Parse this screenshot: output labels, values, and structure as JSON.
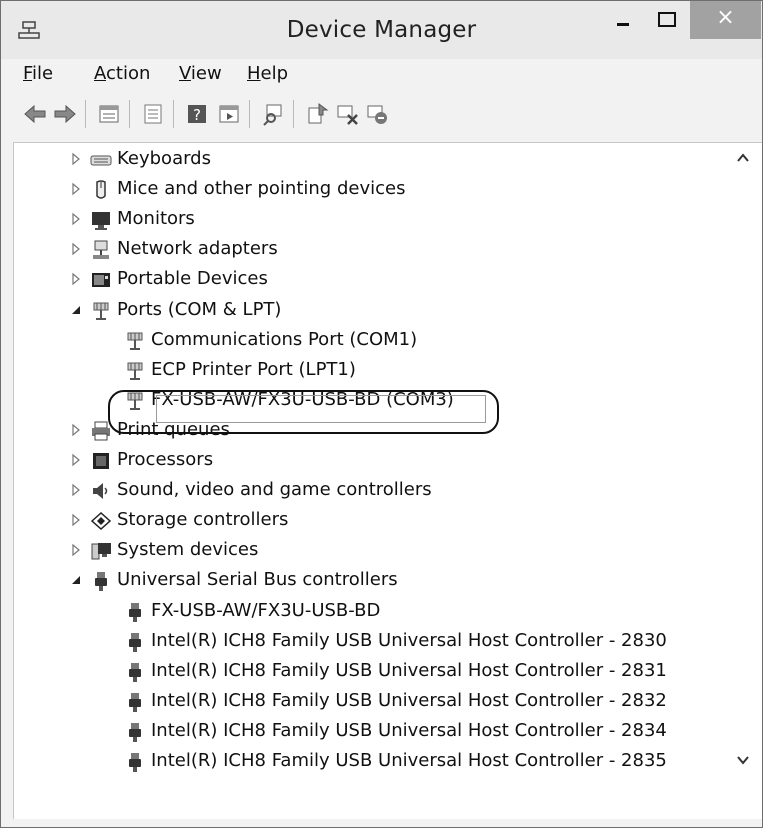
{
  "window": {
    "title": "Device Manager",
    "close_glyph": "×"
  },
  "menubar": {
    "items": [
      {
        "label": "File",
        "mnemonic": "F"
      },
      {
        "label": "Action",
        "mnemonic": "A"
      },
      {
        "label": "View",
        "mnemonic": "V"
      },
      {
        "label": "Help",
        "mnemonic": "H"
      }
    ]
  },
  "toolbar": {
    "buttons": [
      "back-arrow-icon",
      "forward-arrow-icon",
      "properties-icon",
      "view-list-icon",
      "help-icon",
      "run-icon",
      "scan-hardware-icon",
      "update-driver-icon",
      "disable-device-icon",
      "uninstall-device-icon"
    ]
  },
  "tree": {
    "items": [
      {
        "label": "Keyboards",
        "level": 0,
        "state": "collapsed",
        "icon": "keyboard-icon"
      },
      {
        "label": "Mice and other pointing devices",
        "level": 0,
        "state": "collapsed",
        "icon": "mouse-icon"
      },
      {
        "label": "Monitors",
        "level": 0,
        "state": "collapsed",
        "icon": "monitor-icon"
      },
      {
        "label": "Network adapters",
        "level": 0,
        "state": "collapsed",
        "icon": "network-icon"
      },
      {
        "label": "Portable Devices",
        "level": 0,
        "state": "collapsed",
        "icon": "portable-device-icon"
      },
      {
        "label": "Ports (COM & LPT)",
        "level": 0,
        "state": "expanded",
        "icon": "port-icon"
      },
      {
        "label": "Communications Port (COM1)",
        "level": 1,
        "state": "leaf",
        "icon": "port-icon"
      },
      {
        "label": "ECP Printer Port (LPT1)",
        "level": 1,
        "state": "leaf",
        "icon": "port-icon"
      },
      {
        "label": "FX-USB-AW/FX3U-USB-BD (COM3)",
        "level": 1,
        "state": "leaf",
        "icon": "port-icon",
        "selected": true
      },
      {
        "label": "Print queues",
        "level": 0,
        "state": "collapsed",
        "icon": "printer-icon"
      },
      {
        "label": "Processors",
        "level": 0,
        "state": "collapsed",
        "icon": "processor-icon"
      },
      {
        "label": "Sound, video and game controllers",
        "level": 0,
        "state": "collapsed",
        "icon": "speaker-icon"
      },
      {
        "label": "Storage controllers",
        "level": 0,
        "state": "collapsed",
        "icon": "storage-icon"
      },
      {
        "label": "System devices",
        "level": 0,
        "state": "collapsed",
        "icon": "system-device-icon"
      },
      {
        "label": "Universal Serial Bus controllers",
        "level": 0,
        "state": "expanded",
        "icon": "usb-plug-icon"
      },
      {
        "label": "FX-USB-AW/FX3U-USB-BD",
        "level": 1,
        "state": "leaf",
        "icon": "usb-plug-icon"
      },
      {
        "label": "Intel(R) ICH8 Family USB Universal Host Controller - 2830",
        "level": 1,
        "state": "leaf",
        "icon": "usb-plug-icon"
      },
      {
        "label": "Intel(R) ICH8 Family USB Universal Host Controller - 2831",
        "level": 1,
        "state": "leaf",
        "icon": "usb-plug-icon"
      },
      {
        "label": "Intel(R) ICH8 Family USB Universal Host Controller - 2832",
        "level": 1,
        "state": "leaf",
        "icon": "usb-plug-icon"
      },
      {
        "label": "Intel(R) ICH8 Family USB Universal Host Controller - 2834",
        "level": 1,
        "state": "leaf",
        "icon": "usb-plug-icon"
      },
      {
        "label": "Intel(R) ICH8 Family USB Universal Host Controller - 2835",
        "level": 1,
        "state": "leaf",
        "icon": "usb-plug-icon"
      }
    ]
  }
}
